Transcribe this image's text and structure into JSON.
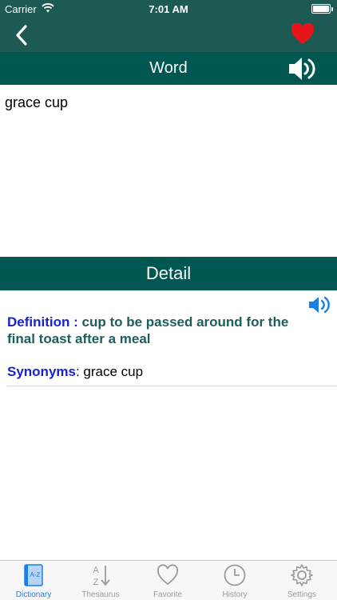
{
  "status_bar": {
    "carrier": "Carrier",
    "time": "7:01 AM"
  },
  "nav": {
    "back_icon": "chevron-left-icon",
    "favorite_icon": "heart-icon",
    "favorite_color": "#e8141b"
  },
  "word_section": {
    "title": "Word",
    "word": "grace cup"
  },
  "detail_section": {
    "title": "Detail",
    "definition_label": "Definition :",
    "definition_text": "cup to be passed around for the final toast after a meal",
    "synonyms_label": "Synonyms",
    "synonyms_text": ": grace cup"
  },
  "tabs": [
    {
      "label": "Dictionary",
      "icon": "dictionary-book-icon",
      "active": true
    },
    {
      "label": "Thesaurus",
      "icon": "az-sort-icon",
      "active": false
    },
    {
      "label": "Favorite",
      "icon": "heart-outline-icon",
      "active": false
    },
    {
      "label": "History",
      "icon": "clock-icon",
      "active": false
    },
    {
      "label": "Settings",
      "icon": "gear-icon",
      "active": false
    }
  ],
  "colors": {
    "header_dark": "#1d5a53",
    "section_bar": "#005650",
    "label_blue": "#1a22c9",
    "definition_green": "#1c5e58",
    "tab_active": "#1a7ee8",
    "speaker_blue": "#1a7ee8"
  }
}
